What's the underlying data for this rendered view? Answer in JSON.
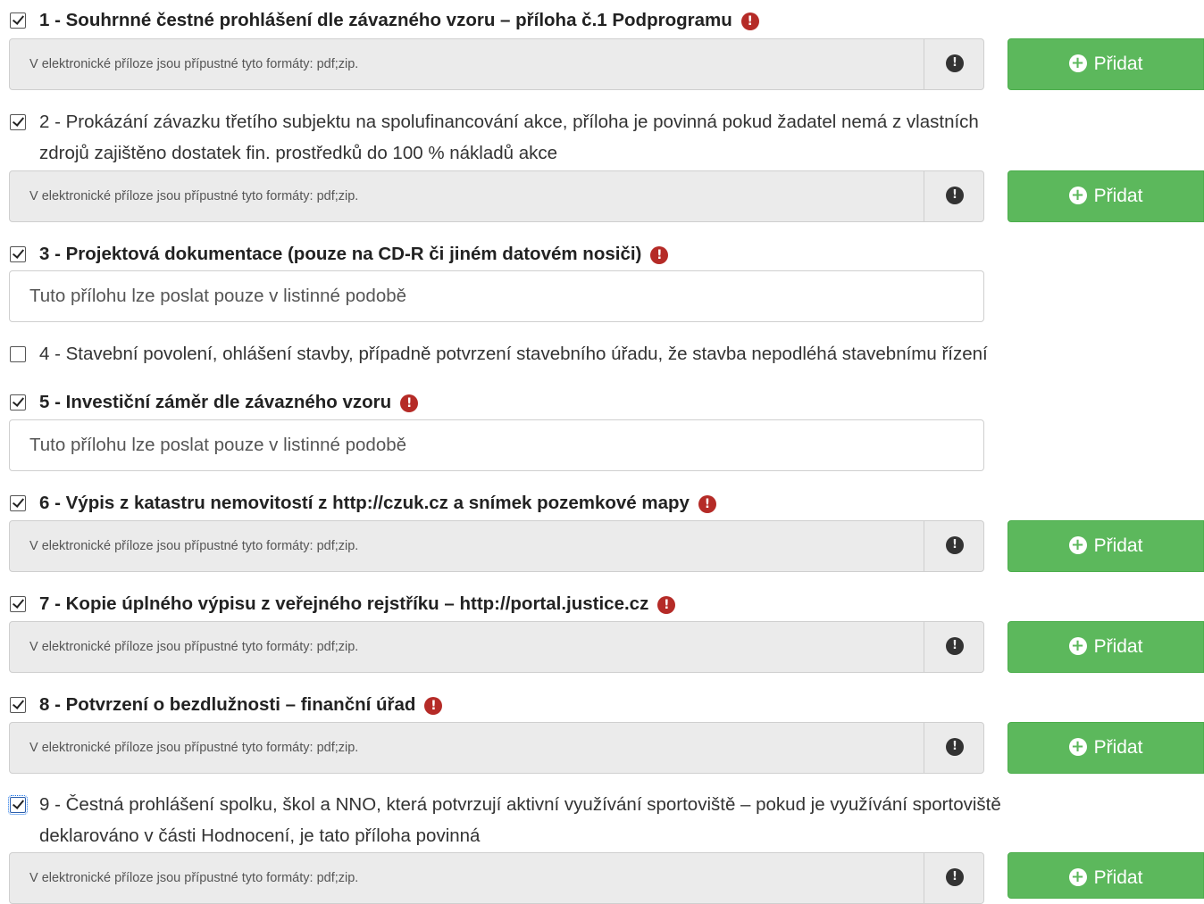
{
  "upload_hint": "V elektronické příloze jsou přípustné tyto formáty: pdf;zip.",
  "add_label": "Přidat",
  "paper_only_text": "Tuto přílohu lze poslat pouze v listinné podobě",
  "required_icon": "exclamation-circle-icon",
  "info_icon": "exclamation-circle-icon",
  "colors": {
    "add_button": "#5cb85c",
    "required": "#b52b27"
  },
  "items": [
    {
      "label": "1 - Souhrnné čestné prohlášení dle závazného vzoru – příloha č.1 Podprogramu",
      "checked": true,
      "required": true
    },
    {
      "label_line1": "2 - Prokázání závazku třetího subjektu na spolufinancování akce, příloha je povinná pokud žadatel nemá z vlastních",
      "label_line2": "zdrojů zajištěno dostatek fin. prostředků do 100 % nákladů akce",
      "checked": true,
      "required": false
    },
    {
      "label": "3 - Projektová dokumentace (pouze na CD-R či jiném datovém nosiči)",
      "checked": true,
      "required": true
    },
    {
      "label": "4 - Stavební povolení, ohlášení stavby, případně potvrzení stavebního úřadu, že stavba nepodléhá stavebnímu řízení",
      "checked": false,
      "required": false
    },
    {
      "label": "5 - Investiční záměr dle závazného vzoru",
      "checked": true,
      "required": true
    },
    {
      "label": "6 - Výpis z katastru nemovitostí z http://czuk.cz a snímek pozemkové mapy",
      "checked": true,
      "required": true
    },
    {
      "label": "7 - Kopie úplného výpisu z veřejného rejstříku – http://portal.justice.cz",
      "checked": true,
      "required": true
    },
    {
      "label": "8 - Potvrzení o bezdlužnosti – finanční úřad",
      "checked": true,
      "required": true
    },
    {
      "label_line1": "9 - Čestná prohlášení spolku, škol a NNO, která potvrzují aktivní využívání sportoviště – pokud je využívání sportoviště",
      "label_line2": "deklarováno v části Hodnocení, je tato příloha povinná",
      "checked": true,
      "required": false
    }
  ]
}
